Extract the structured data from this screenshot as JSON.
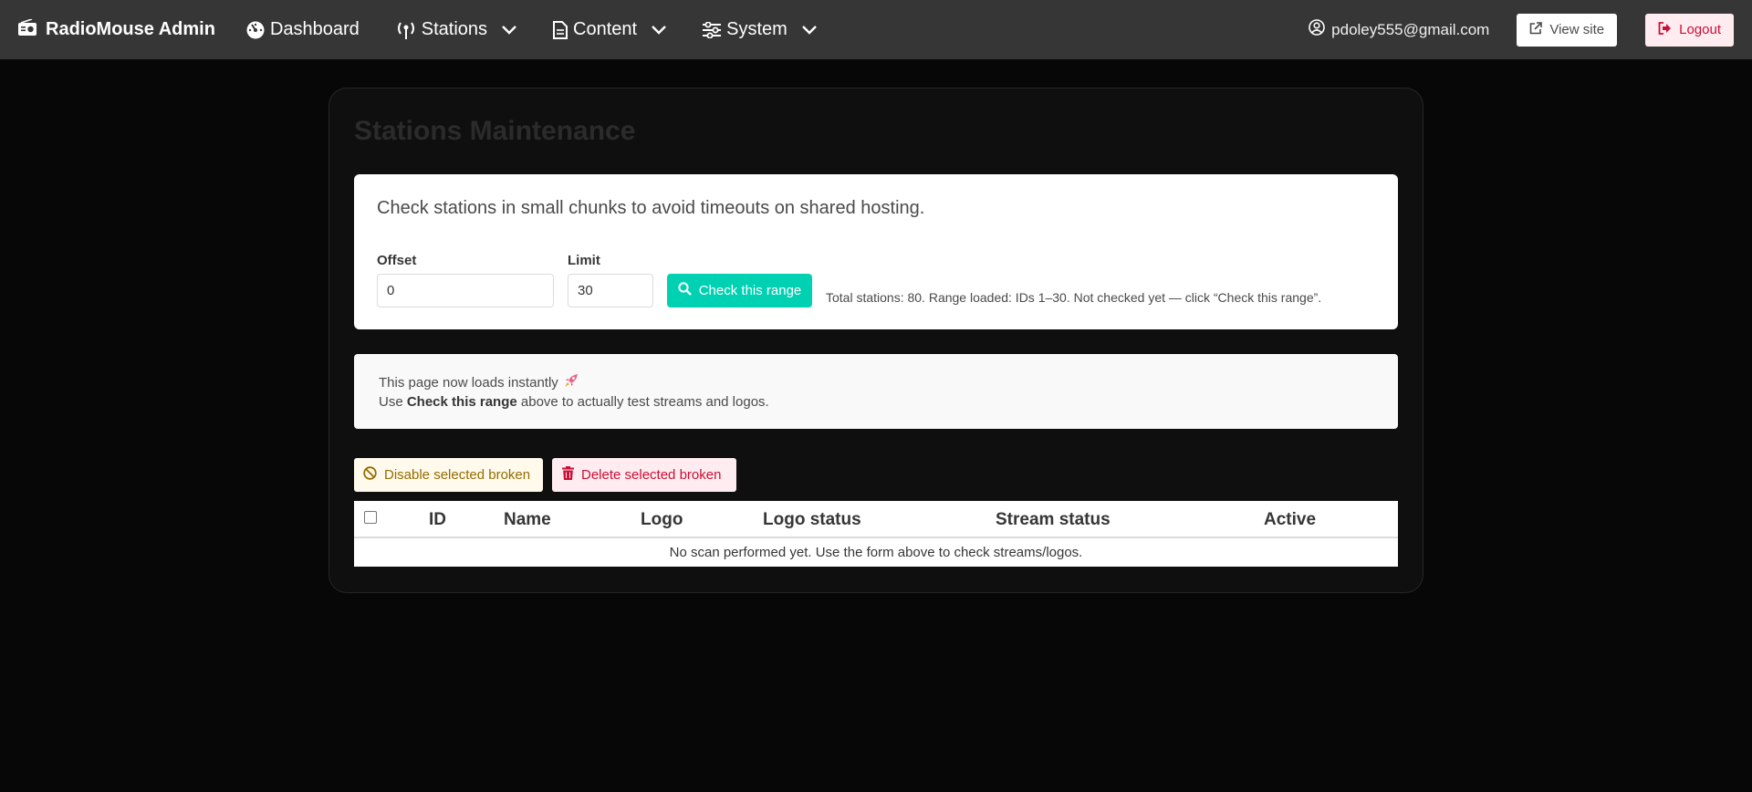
{
  "nav": {
    "brand": "RadioMouse Admin",
    "items": [
      {
        "label": "Dashboard"
      },
      {
        "label": "Stations"
      },
      {
        "label": "Content"
      },
      {
        "label": "System"
      }
    ],
    "user_email": "pdoley555@gmail.com",
    "view_site": "View site",
    "logout": "Logout"
  },
  "page": {
    "title": "Stations Maintenance"
  },
  "range_form": {
    "lead": "Check stations in small chunks to avoid timeouts on shared hosting.",
    "offset_label": "Offset",
    "offset_value": "0",
    "limit_label": "Limit",
    "limit_value": "30",
    "check_button": "Check this range",
    "summary": "Total stations: 80. Range loaded: IDs 1–30. Not checked yet — click “Check this range”."
  },
  "notice": {
    "line1": "This page now loads instantly",
    "line2_prefix": "Use ",
    "line2_bold": "Check this range",
    "line2_suffix": " above to actually test streams and logos."
  },
  "actions": {
    "disable": "Disable selected broken",
    "delete": "Delete selected broken"
  },
  "table": {
    "columns": [
      "ID",
      "Name",
      "Logo",
      "Logo status",
      "Stream status",
      "Active"
    ],
    "empty_message": "No scan performed yet. Use the form above to check streams/logos."
  },
  "colors": {
    "navbar": "#363636",
    "background": "#070707",
    "primary": "#00d1b2",
    "warning_text": "#946c00",
    "danger_text": "#cc0f35"
  }
}
